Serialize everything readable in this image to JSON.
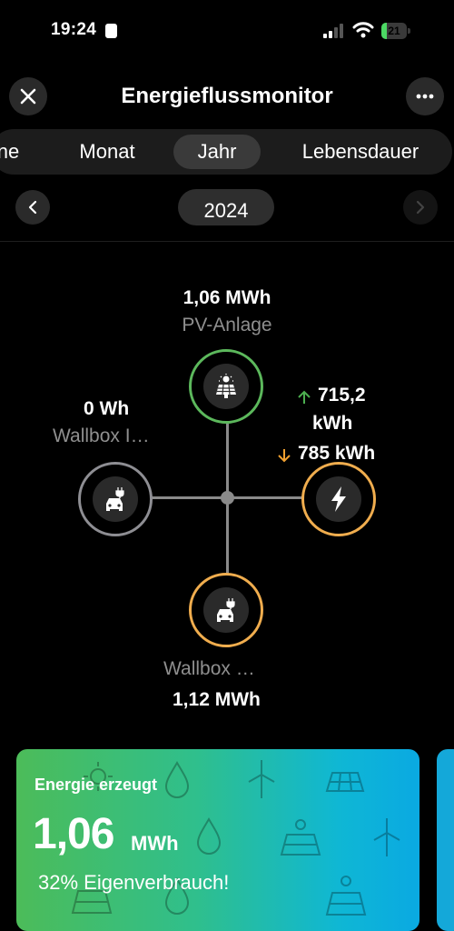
{
  "status_bar": {
    "time": "19:24",
    "battery": "21",
    "battery_level": 0.21
  },
  "header": {
    "title": "Energieflussmonitor"
  },
  "tabs": [
    {
      "label": "ne",
      "active": false
    },
    {
      "label": "Monat",
      "active": false
    },
    {
      "label": "Jahr",
      "active": true
    },
    {
      "label": "Lebensdauer",
      "active": false
    }
  ],
  "period": {
    "year": "2024"
  },
  "flow": {
    "pv": {
      "value": "1,06  MWh",
      "label": "PV-Anlage",
      "color": "#5cb85c",
      "icon": "solar-panel-icon"
    },
    "wallbox_left": {
      "value": "0  Wh",
      "label": "Wallbox I…",
      "color": "#8e8e93",
      "icon": "ev-car-icon"
    },
    "grid": {
      "export": "715,2",
      "export_unit": "kWh",
      "import": "785  kWh",
      "color": "#f0ad4e",
      "icon": "lightning-icon"
    },
    "wallbox_bottom": {
      "value": "1,12  MWh",
      "label": "Wallbox …",
      "color": "#f0ad4e",
      "icon": "ev-car-icon"
    },
    "arrow_up_color": "#4caf50",
    "arrow_down_color": "#f0a030"
  },
  "card": {
    "title": "Energie erzeugt",
    "value": "1,06",
    "unit": "MWh",
    "subtitle": "32% Eigenverbrauch!"
  }
}
